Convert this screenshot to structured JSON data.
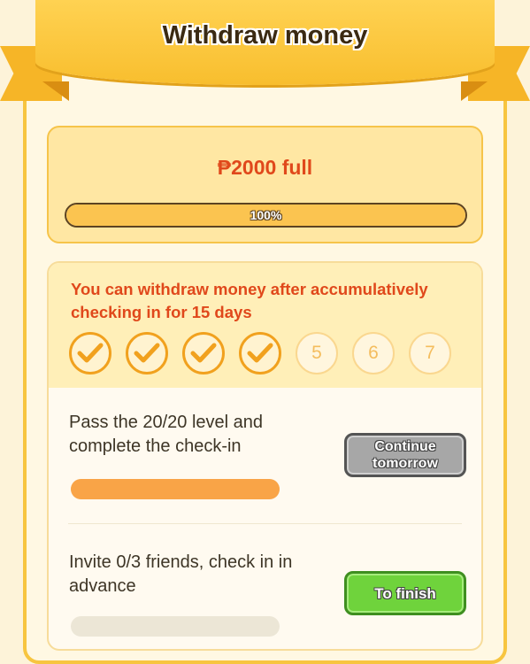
{
  "dialog": {
    "title": "Withdraw money"
  },
  "amount": {
    "label": "₱2000 full",
    "progress_percent": 100,
    "progress_label": "100%"
  },
  "checkin": {
    "description": "You can withdraw money after accumulatively checking in for 15 days",
    "days": [
      {
        "label": "1",
        "checked": true
      },
      {
        "label": "2",
        "checked": true
      },
      {
        "label": "3",
        "checked": true
      },
      {
        "label": "4",
        "checked": true
      },
      {
        "label": "5",
        "checked": false
      },
      {
        "label": "6",
        "checked": false
      },
      {
        "label": "7",
        "checked": false
      }
    ]
  },
  "tasks": [
    {
      "title": "Pass the 20/20 level and complete the check-in",
      "button_label": "Continue tomorrow",
      "button_state": "disabled",
      "progress_fraction": 1.0
    },
    {
      "title": "Invite 0/3 friends, check in in advance",
      "button_label": "To finish",
      "button_state": "active",
      "progress_fraction": 0.0
    }
  ],
  "colors": {
    "accent_orange": "#e0481b",
    "ribbon": "#f8be2e",
    "check": "#f1a11e",
    "button_green": "#6fd33c",
    "button_grey": "#a7a7a7"
  }
}
